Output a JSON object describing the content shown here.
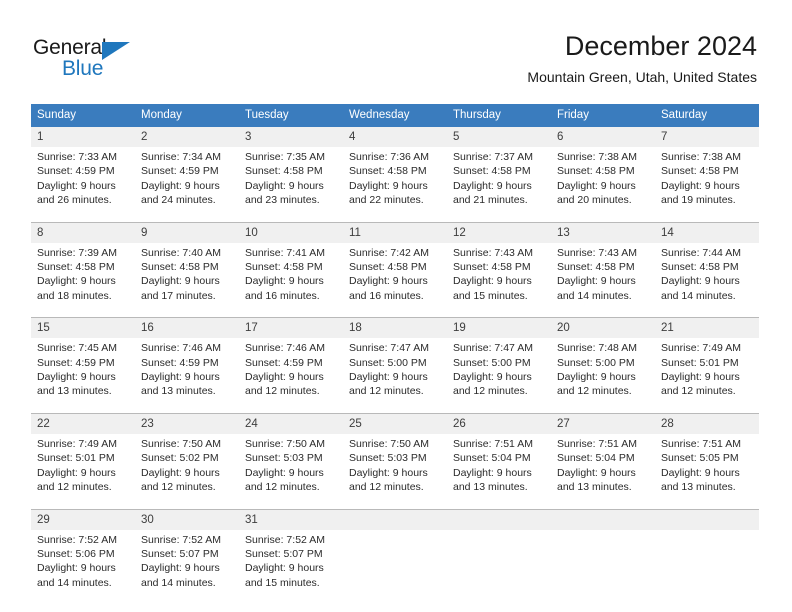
{
  "logo": {
    "word_top": "General",
    "word_bottom": "Blue",
    "accent_color": "#1f77bd"
  },
  "header": {
    "title": "December 2024",
    "subtitle": "Mountain Green, Utah, United States"
  },
  "calendar": {
    "header_bg": "#3a7cbe",
    "daynum_bg": "#f0f0f0",
    "weekday_headers": [
      "Sunday",
      "Monday",
      "Tuesday",
      "Wednesday",
      "Thursday",
      "Friday",
      "Saturday"
    ],
    "weeks": [
      [
        {
          "day": "1",
          "sunrise": "Sunrise: 7:33 AM",
          "sunset": "Sunset: 4:59 PM",
          "daylight1": "Daylight: 9 hours",
          "daylight2": "and 26 minutes."
        },
        {
          "day": "2",
          "sunrise": "Sunrise: 7:34 AM",
          "sunset": "Sunset: 4:59 PM",
          "daylight1": "Daylight: 9 hours",
          "daylight2": "and 24 minutes."
        },
        {
          "day": "3",
          "sunrise": "Sunrise: 7:35 AM",
          "sunset": "Sunset: 4:58 PM",
          "daylight1": "Daylight: 9 hours",
          "daylight2": "and 23 minutes."
        },
        {
          "day": "4",
          "sunrise": "Sunrise: 7:36 AM",
          "sunset": "Sunset: 4:58 PM",
          "daylight1": "Daylight: 9 hours",
          "daylight2": "and 22 minutes."
        },
        {
          "day": "5",
          "sunrise": "Sunrise: 7:37 AM",
          "sunset": "Sunset: 4:58 PM",
          "daylight1": "Daylight: 9 hours",
          "daylight2": "and 21 minutes."
        },
        {
          "day": "6",
          "sunrise": "Sunrise: 7:38 AM",
          "sunset": "Sunset: 4:58 PM",
          "daylight1": "Daylight: 9 hours",
          "daylight2": "and 20 minutes."
        },
        {
          "day": "7",
          "sunrise": "Sunrise: 7:38 AM",
          "sunset": "Sunset: 4:58 PM",
          "daylight1": "Daylight: 9 hours",
          "daylight2": "and 19 minutes."
        }
      ],
      [
        {
          "day": "8",
          "sunrise": "Sunrise: 7:39 AM",
          "sunset": "Sunset: 4:58 PM",
          "daylight1": "Daylight: 9 hours",
          "daylight2": "and 18 minutes."
        },
        {
          "day": "9",
          "sunrise": "Sunrise: 7:40 AM",
          "sunset": "Sunset: 4:58 PM",
          "daylight1": "Daylight: 9 hours",
          "daylight2": "and 17 minutes."
        },
        {
          "day": "10",
          "sunrise": "Sunrise: 7:41 AM",
          "sunset": "Sunset: 4:58 PM",
          "daylight1": "Daylight: 9 hours",
          "daylight2": "and 16 minutes."
        },
        {
          "day": "11",
          "sunrise": "Sunrise: 7:42 AM",
          "sunset": "Sunset: 4:58 PM",
          "daylight1": "Daylight: 9 hours",
          "daylight2": "and 16 minutes."
        },
        {
          "day": "12",
          "sunrise": "Sunrise: 7:43 AM",
          "sunset": "Sunset: 4:58 PM",
          "daylight1": "Daylight: 9 hours",
          "daylight2": "and 15 minutes."
        },
        {
          "day": "13",
          "sunrise": "Sunrise: 7:43 AM",
          "sunset": "Sunset: 4:58 PM",
          "daylight1": "Daylight: 9 hours",
          "daylight2": "and 14 minutes."
        },
        {
          "day": "14",
          "sunrise": "Sunrise: 7:44 AM",
          "sunset": "Sunset: 4:58 PM",
          "daylight1": "Daylight: 9 hours",
          "daylight2": "and 14 minutes."
        }
      ],
      [
        {
          "day": "15",
          "sunrise": "Sunrise: 7:45 AM",
          "sunset": "Sunset: 4:59 PM",
          "daylight1": "Daylight: 9 hours",
          "daylight2": "and 13 minutes."
        },
        {
          "day": "16",
          "sunrise": "Sunrise: 7:46 AM",
          "sunset": "Sunset: 4:59 PM",
          "daylight1": "Daylight: 9 hours",
          "daylight2": "and 13 minutes."
        },
        {
          "day": "17",
          "sunrise": "Sunrise: 7:46 AM",
          "sunset": "Sunset: 4:59 PM",
          "daylight1": "Daylight: 9 hours",
          "daylight2": "and 12 minutes."
        },
        {
          "day": "18",
          "sunrise": "Sunrise: 7:47 AM",
          "sunset": "Sunset: 5:00 PM",
          "daylight1": "Daylight: 9 hours",
          "daylight2": "and 12 minutes."
        },
        {
          "day": "19",
          "sunrise": "Sunrise: 7:47 AM",
          "sunset": "Sunset: 5:00 PM",
          "daylight1": "Daylight: 9 hours",
          "daylight2": "and 12 minutes."
        },
        {
          "day": "20",
          "sunrise": "Sunrise: 7:48 AM",
          "sunset": "Sunset: 5:00 PM",
          "daylight1": "Daylight: 9 hours",
          "daylight2": "and 12 minutes."
        },
        {
          "day": "21",
          "sunrise": "Sunrise: 7:49 AM",
          "sunset": "Sunset: 5:01 PM",
          "daylight1": "Daylight: 9 hours",
          "daylight2": "and 12 minutes."
        }
      ],
      [
        {
          "day": "22",
          "sunrise": "Sunrise: 7:49 AM",
          "sunset": "Sunset: 5:01 PM",
          "daylight1": "Daylight: 9 hours",
          "daylight2": "and 12 minutes."
        },
        {
          "day": "23",
          "sunrise": "Sunrise: 7:50 AM",
          "sunset": "Sunset: 5:02 PM",
          "daylight1": "Daylight: 9 hours",
          "daylight2": "and 12 minutes."
        },
        {
          "day": "24",
          "sunrise": "Sunrise: 7:50 AM",
          "sunset": "Sunset: 5:03 PM",
          "daylight1": "Daylight: 9 hours",
          "daylight2": "and 12 minutes."
        },
        {
          "day": "25",
          "sunrise": "Sunrise: 7:50 AM",
          "sunset": "Sunset: 5:03 PM",
          "daylight1": "Daylight: 9 hours",
          "daylight2": "and 12 minutes."
        },
        {
          "day": "26",
          "sunrise": "Sunrise: 7:51 AM",
          "sunset": "Sunset: 5:04 PM",
          "daylight1": "Daylight: 9 hours",
          "daylight2": "and 13 minutes."
        },
        {
          "day": "27",
          "sunrise": "Sunrise: 7:51 AM",
          "sunset": "Sunset: 5:04 PM",
          "daylight1": "Daylight: 9 hours",
          "daylight2": "and 13 minutes."
        },
        {
          "day": "28",
          "sunrise": "Sunrise: 7:51 AM",
          "sunset": "Sunset: 5:05 PM",
          "daylight1": "Daylight: 9 hours",
          "daylight2": "and 13 minutes."
        }
      ],
      [
        {
          "day": "29",
          "sunrise": "Sunrise: 7:52 AM",
          "sunset": "Sunset: 5:06 PM",
          "daylight1": "Daylight: 9 hours",
          "daylight2": "and 14 minutes."
        },
        {
          "day": "30",
          "sunrise": "Sunrise: 7:52 AM",
          "sunset": "Sunset: 5:07 PM",
          "daylight1": "Daylight: 9 hours",
          "daylight2": "and 14 minutes."
        },
        {
          "day": "31",
          "sunrise": "Sunrise: 7:52 AM",
          "sunset": "Sunset: 5:07 PM",
          "daylight1": "Daylight: 9 hours",
          "daylight2": "and 15 minutes."
        },
        {
          "day": "",
          "sunrise": "",
          "sunset": "",
          "daylight1": "",
          "daylight2": ""
        },
        {
          "day": "",
          "sunrise": "",
          "sunset": "",
          "daylight1": "",
          "daylight2": ""
        },
        {
          "day": "",
          "sunrise": "",
          "sunset": "",
          "daylight1": "",
          "daylight2": ""
        },
        {
          "day": "",
          "sunrise": "",
          "sunset": "",
          "daylight1": "",
          "daylight2": ""
        }
      ]
    ]
  }
}
